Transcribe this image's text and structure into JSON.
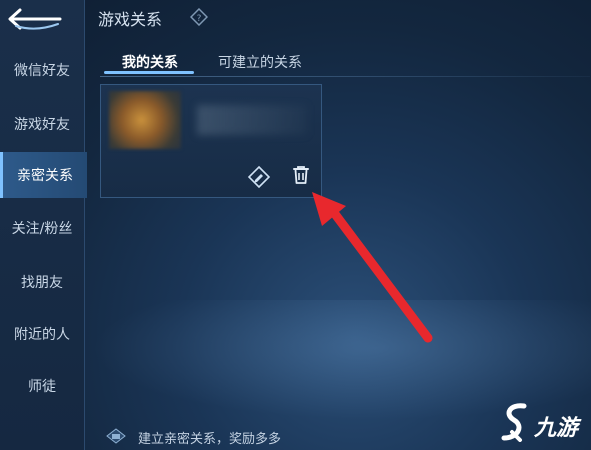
{
  "header": {
    "title": "游戏关系"
  },
  "sidebar": {
    "items": [
      {
        "label": "微信好友"
      },
      {
        "label": "游戏好友"
      },
      {
        "label": "亲密关系",
        "active": true
      },
      {
        "label": "关注/粉丝"
      },
      {
        "label": "找朋友"
      },
      {
        "label": "附近的人"
      },
      {
        "label": "师徒"
      }
    ]
  },
  "tabs": [
    {
      "label": "我的关系",
      "active": true
    },
    {
      "label": "可建立的关系"
    }
  ],
  "card": {
    "actions": [
      "edit-icon",
      "delete-icon"
    ]
  },
  "footer": {
    "text": "建立亲密关系，奖励多多"
  },
  "watermark": {
    "text": "九游"
  },
  "colors": {
    "accent": "#7fc2ff",
    "arrow": "#e8282d",
    "background": "#13273f"
  }
}
